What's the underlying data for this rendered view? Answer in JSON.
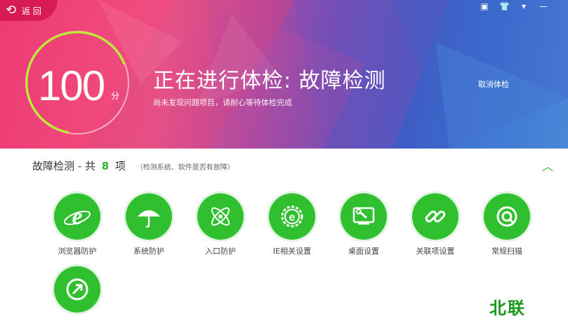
{
  "header": {
    "back_label": "返 回",
    "window_controls": [
      "restore-icon",
      "shirt-icon",
      "menu-icon",
      "minimize-icon"
    ],
    "score": "100",
    "score_unit": "分",
    "title": "正在进行体检: 故障检测",
    "subtitle": "尚未发现问题项目，请耐心等待体检完成",
    "cancel_label": "取消体检"
  },
  "section": {
    "title_prefix": "故障检测 - 共",
    "count": "8",
    "title_suffix": "项",
    "note": "（检测系统、软件是否有故障）"
  },
  "items": [
    {
      "label": "浏览器防护",
      "icon": "ie-icon"
    },
    {
      "label": "系统防护",
      "icon": "umbrella-icon"
    },
    {
      "label": "入口防护",
      "icon": "atom-icon"
    },
    {
      "label": "IE相关设置",
      "icon": "ie-gear-icon"
    },
    {
      "label": "桌面设置",
      "icon": "desktop-wrench-icon"
    },
    {
      "label": "关联项设置",
      "icon": "link-icon"
    },
    {
      "label": "常规扫描",
      "icon": "scan-icon"
    },
    {
      "label": "",
      "icon": "shortcut-arrow-icon"
    }
  ],
  "watermark": "北联",
  "colors": {
    "accent_green": "#2fbf2f",
    "back_pink": "#d81b55"
  }
}
